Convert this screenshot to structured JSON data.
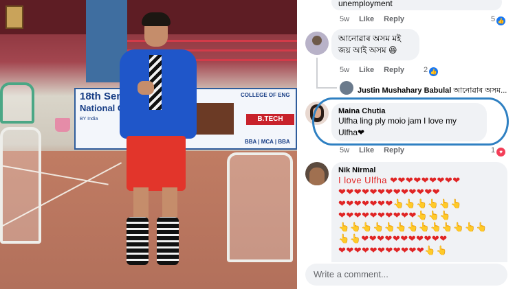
{
  "photo": {
    "banner_title": "18th Semi",
    "banner_sub": "National C",
    "banner_by": "BY India",
    "banner_college": "COLLEGE OF ENG",
    "banner_btech": "B.TECH",
    "banner_courses": "BBA | MCA | BBA"
  },
  "comments": [
    {
      "id": "c0",
      "text": "unemployment",
      "time": "5w",
      "like_label": "Like",
      "reply_label": "Reply",
      "reactions": "5",
      "reaction_icon": "like-icon"
    },
    {
      "id": "c1",
      "author": "আনোৱাৰ অসম মই",
      "text": "জয় আই অসম 😆",
      "time": "5w",
      "like_label": "Like",
      "reply_label": "Reply",
      "reactions": "2",
      "reaction_icon": "like-icon"
    },
    {
      "id": "c1-reply",
      "author": "Justin Mushahary Babulal",
      "text": "আনোৱাৰ অসম..."
    },
    {
      "id": "c2",
      "author": "Maina Chutia",
      "text_line1": "Ulfha ling ply moio jam I love my",
      "text_line2": "Ulfha❤",
      "time": "5w",
      "like_label": "Like",
      "reply_label": "Reply",
      "reactions": "1",
      "reaction_icon": "love-icon"
    },
    {
      "id": "c3",
      "author": "Nik Nirmal",
      "text": "I love Ulfha ❤❤❤❤❤❤❤❤❤",
      "emoji_rows": [
        "❤❤❤❤❤❤❤❤❤❤❤❤❤",
        "❤❤❤❤❤❤❤👆👆👆👆👆👆",
        "❤❤❤❤❤❤❤❤❤❤👆👆👆",
        "👆👆👆👆👆👆👆👆👆👆👆👆👆",
        "👆👆❤❤❤❤❤❤❤❤❤❤❤",
        "❤❤❤❤❤❤❤❤❤❤❤👆👆"
      ]
    }
  ],
  "composer": {
    "placeholder": "Write a comment..."
  },
  "colors": {
    "facebook_blue": "#1877f2",
    "love_red": "#f33e58",
    "bubble_gray": "#f0f2f5",
    "highlight_blue": "#2f80c2"
  }
}
